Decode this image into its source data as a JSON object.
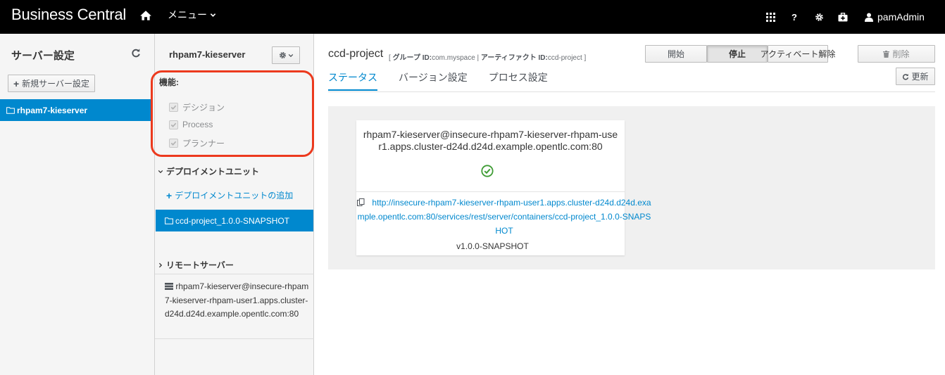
{
  "navbar": {
    "brand": "Business Central",
    "menu_label": "メニュー",
    "user": "pamAdmin"
  },
  "server_config": {
    "title": "サーバー設定",
    "new_button": "新規サーバー設定",
    "servers": [
      "rhpam7-kieserver"
    ]
  },
  "server_detail": {
    "name": "rhpam7-kieserver",
    "features_label": "機能:",
    "features": [
      {
        "label": "デシジョン",
        "checked": true
      },
      {
        "label": "Process",
        "checked": true
      },
      {
        "label": "プランナー",
        "checked": true
      }
    ],
    "deployment_units_label": "デプロイメントユニット",
    "add_unit_link": "デプロイメントユニットの追加",
    "units": [
      "ccd-project_1.0.0-SNAPSHOT"
    ],
    "remote_servers_label": "リモートサーバー",
    "remote_servers": [
      "rhpam7-kieserver@insecure-rhpam7-kieserver-rhpam-user1.apps.cluster-d24d.d24d.example.opentlc.com:80"
    ]
  },
  "project": {
    "name": "ccd-project",
    "group_label": "グループ ID:",
    "group_id": "com.myspace",
    "artifact_label": "アーティファクト ID:",
    "artifact_id": "ccd-project",
    "actions": {
      "start": "開始",
      "stop": "停止",
      "deactivate": "アクティベート解除",
      "delete": "削除",
      "refresh": "更新"
    },
    "tabs": [
      "ステータス",
      "バージョン設定",
      "プロセス設定"
    ],
    "active_tab": "ステータス"
  },
  "status_card": {
    "server_url": "rhpam7-kieserver@insecure-rhpam7-kieserver-rhpam-user1.apps.cluster-d24d.d24d.example.opentlc.com:80",
    "endpoint": "http://insecure-rhpam7-kieserver-rhpam-user1.apps.cluster-d24d.d24d.example.opentlc.com:80/services/rest/server/containers/ccd-project_1.0.0-SNAPSHOT",
    "version": "v1.0.0-SNAPSHOT",
    "status_color": "#3f9c35"
  },
  "colors": {
    "accent": "#0088ce",
    "highlight_outline": "#ec3a1e",
    "navbar": "#000000"
  }
}
